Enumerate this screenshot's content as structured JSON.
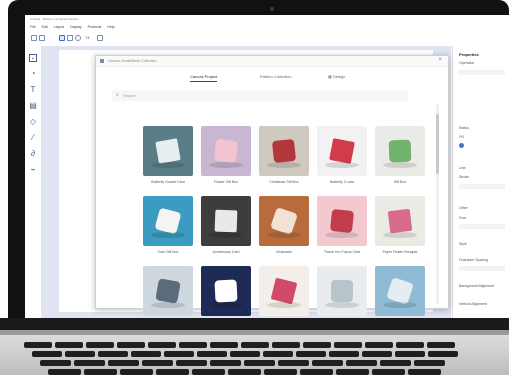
{
  "app": {
    "title": "Untitled - Brother CanvasWorkspace",
    "menu": [
      "File",
      "Edit",
      "Layout",
      "Display",
      "Products",
      "Help"
    ],
    "zoom": "74"
  },
  "properties": {
    "title": "Properties",
    "labels": [
      "Operation",
      "Status",
      "Fill",
      "Line",
      "Stroke",
      "Other",
      "Font",
      "Style",
      "Character Spacing",
      "Background Alignment",
      "Vertical Alignment"
    ]
  },
  "dialog": {
    "title": "Canvas CreateMode Collection",
    "close": "×",
    "tabs": [
      "Canvas Project",
      "Pattern Collection",
      "Design"
    ],
    "active_tab": "Canvas Project",
    "search_placeholder": "Search"
  },
  "projects": [
    {
      "label": "Butterfly Gusset Card",
      "bg": "#5a7d88",
      "accent": "#e6eef2"
    },
    {
      "label": "Flower Gift Box",
      "bg": "#c9b6d2",
      "accent": "#f2c4cf"
    },
    {
      "label": "Christmas Gift Box",
      "bg": "#cfc9bf",
      "accent": "#b3363a"
    },
    {
      "label": "Butterfly Z-card",
      "bg": "#f2f2f2",
      "accent": "#d23b4b"
    },
    {
      "label": "Gift Box",
      "bg": "#e9ece6",
      "accent": "#6fb36d"
    },
    {
      "label": "Cute Gift Box",
      "bg": "#3b9bc0",
      "accent": "#f4f4f4"
    },
    {
      "label": "Anniversary Card",
      "bg": "#3d3d3d",
      "accent": "#e9e9e9"
    },
    {
      "label": "Keepsake",
      "bg": "#b96b3c",
      "accent": "#f1e2d3"
    },
    {
      "label": "Thank You Popup Card",
      "bg": "#f1c9cf",
      "accent": "#c23c4c"
    },
    {
      "label": "Paper Flower Bouquet",
      "bg": "#ebebe6",
      "accent": "#d86a8a"
    },
    {
      "label": "",
      "bg": "#cfd7de",
      "accent": "#5a6c7c"
    },
    {
      "label": "",
      "bg": "#1f2b57",
      "accent": "#ffffff"
    },
    {
      "label": "",
      "bg": "#f3eee9",
      "accent": "#d24a68"
    },
    {
      "label": "",
      "bg": "#e9ecef",
      "accent": "#b8c4cc"
    },
    {
      "label": "",
      "bg": "#8fbcd4",
      "accent": "#e4edf3"
    }
  ]
}
